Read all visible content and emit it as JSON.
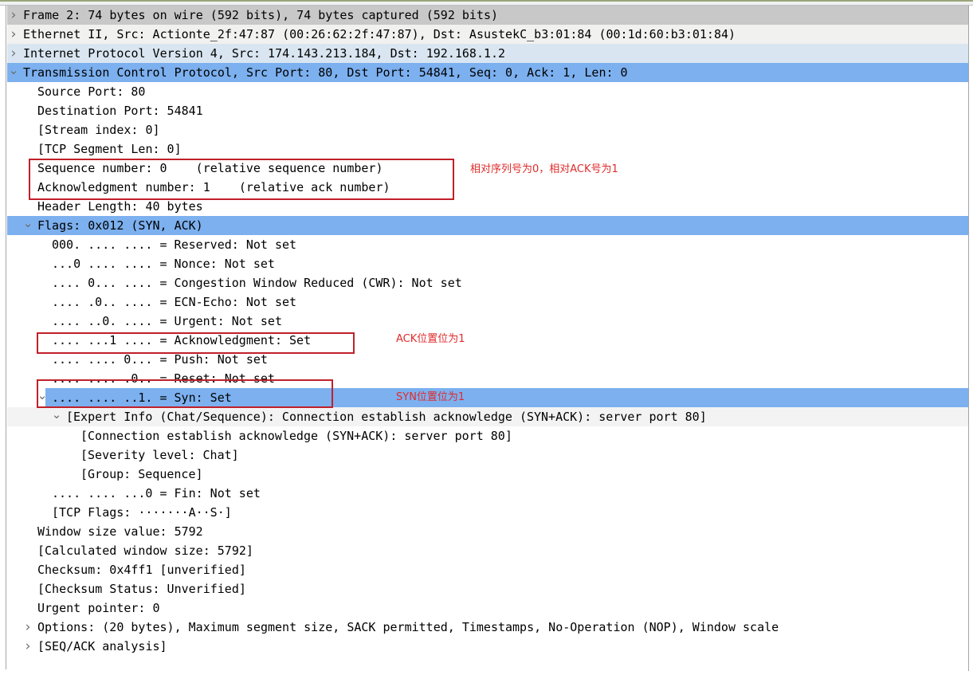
{
  "window": {
    "title": "Wireshark Packet Details",
    "background_color": "#ffffff"
  },
  "colors": {
    "row_frame_bg": "#c8c8c8",
    "row_ethernet_bg": "#f1f1f0",
    "row_ip_bg": "#d9e6f1",
    "row_selected_bg": "#7cb0ef",
    "annotation_red": "#e02b2b",
    "redbox_border": "#c0202a",
    "text": "#000000"
  },
  "tree": {
    "rows": [
      {
        "id": "frame",
        "indent": 0,
        "arrow": "closed",
        "bg": "gray",
        "text": "Frame 2: 74 bytes on wire (592 bits), 74 bytes captured (592 bits)"
      },
      {
        "id": "ethernet",
        "indent": 0,
        "arrow": "closed",
        "bg": "white",
        "text": "Ethernet II, Src: Actionte_2f:47:87 (00:26:62:2f:47:87), Dst: AsustekC_b3:01:84 (00:1d:60:b3:01:84)"
      },
      {
        "id": "ipv4",
        "indent": 0,
        "arrow": "closed",
        "bg": "lblue",
        "text": "Internet Protocol Version 4, Src: 174.143.213.184, Dst: 192.168.1.2"
      },
      {
        "id": "tcp",
        "indent": 0,
        "arrow": "open",
        "bg": "sel",
        "text": "Transmission Control Protocol, Src Port: 80, Dst Port: 54841, Seq: 0, Ack: 1, Len: 0"
      },
      {
        "id": "src-port",
        "indent": 1,
        "arrow": "none",
        "bg": "plain",
        "text": "Source Port: 80"
      },
      {
        "id": "dst-port",
        "indent": 1,
        "arrow": "none",
        "bg": "plain",
        "text": "Destination Port: 54841"
      },
      {
        "id": "stream-index",
        "indent": 1,
        "arrow": "none",
        "bg": "plain",
        "text": "[Stream index: 0]"
      },
      {
        "id": "segment-len",
        "indent": 1,
        "arrow": "none",
        "bg": "plain",
        "text": "[TCP Segment Len: 0]"
      },
      {
        "id": "seq-number",
        "indent": 1,
        "arrow": "none",
        "bg": "plain",
        "text": "Sequence number: 0    (relative sequence number)"
      },
      {
        "id": "ack-number",
        "indent": 1,
        "arrow": "none",
        "bg": "plain",
        "text": "Acknowledgment number: 1    (relative ack number)"
      },
      {
        "id": "header-len",
        "indent": 1,
        "arrow": "none",
        "bg": "plain",
        "text": "Header Length: 40 bytes"
      },
      {
        "id": "flags",
        "indent": 1,
        "arrow": "open",
        "bg": "sel",
        "text": "Flags: 0x012 (SYN, ACK)"
      },
      {
        "id": "flag-reserved",
        "indent": 2,
        "arrow": "none",
        "bg": "plain",
        "text": "000. .... .... = Reserved: Not set"
      },
      {
        "id": "flag-nonce",
        "indent": 2,
        "arrow": "none",
        "bg": "plain",
        "text": "...0 .... .... = Nonce: Not set"
      },
      {
        "id": "flag-cwr",
        "indent": 2,
        "arrow": "none",
        "bg": "plain",
        "text": ".... 0... .... = Congestion Window Reduced (CWR): Not set"
      },
      {
        "id": "flag-ecn",
        "indent": 2,
        "arrow": "none",
        "bg": "plain",
        "text": ".... .0.. .... = ECN-Echo: Not set"
      },
      {
        "id": "flag-urgent",
        "indent": 2,
        "arrow": "none",
        "bg": "plain",
        "text": ".... ..0. .... = Urgent: Not set"
      },
      {
        "id": "flag-ack",
        "indent": 2,
        "arrow": "none",
        "bg": "plain",
        "text": ".... ...1 .... = Acknowledgment: Set"
      },
      {
        "id": "flag-push",
        "indent": 2,
        "arrow": "none",
        "bg": "plain",
        "text": ".... .... 0... = Push: Not set"
      },
      {
        "id": "flag-reset",
        "indent": 2,
        "arrow": "none",
        "bg": "plain",
        "text": ".... .... .0.. = Reset: Not set"
      },
      {
        "id": "flag-syn",
        "indent": 2,
        "arrow": "open",
        "bg": "sel-inline",
        "text": ".... .... ..1. = Syn: Set"
      },
      {
        "id": "expert-info",
        "indent": 3,
        "arrow": "open",
        "bg": "faint",
        "text": "[Expert Info (Chat/Sequence): Connection establish acknowledge (SYN+ACK): server port 80]"
      },
      {
        "id": "expert-msg",
        "indent": 4,
        "arrow": "none",
        "bg": "plain",
        "text": "[Connection establish acknowledge (SYN+ACK): server port 80]"
      },
      {
        "id": "severity",
        "indent": 4,
        "arrow": "none",
        "bg": "plain",
        "text": "[Severity level: Chat]"
      },
      {
        "id": "group",
        "indent": 4,
        "arrow": "none",
        "bg": "plain",
        "text": "[Group: Sequence]"
      },
      {
        "id": "flag-fin",
        "indent": 2,
        "arrow": "none",
        "bg": "plain",
        "text": ".... .... ...0 = Fin: Not set"
      },
      {
        "id": "tcp-flags",
        "indent": 2,
        "arrow": "none",
        "bg": "plain",
        "text": "[TCP Flags: ·······A··S·]"
      },
      {
        "id": "window-size",
        "indent": 1,
        "arrow": "none",
        "bg": "plain",
        "text": "Window size value: 5792"
      },
      {
        "id": "calc-window",
        "indent": 1,
        "arrow": "none",
        "bg": "plain",
        "text": "[Calculated window size: 5792]"
      },
      {
        "id": "checksum",
        "indent": 1,
        "arrow": "none",
        "bg": "plain",
        "text": "Checksum: 0x4ff1 [unverified]"
      },
      {
        "id": "checksum-status",
        "indent": 1,
        "arrow": "none",
        "bg": "plain",
        "text": "[Checksum Status: Unverified]"
      },
      {
        "id": "urgent-ptr",
        "indent": 1,
        "arrow": "none",
        "bg": "plain",
        "text": "Urgent pointer: 0"
      },
      {
        "id": "options",
        "indent": 1,
        "arrow": "closed",
        "bg": "plain",
        "text": "Options: (20 bytes), Maximum segment size, SACK permitted, Timestamps, No-Operation (NOP), Window scale"
      },
      {
        "id": "seq-ack-analysis",
        "indent": 1,
        "arrow": "closed",
        "bg": "plain",
        "text": "[SEQ/ACK analysis]"
      }
    ]
  },
  "annotations": {
    "notes": [
      {
        "id": "note-seq-ack",
        "text": "相对序列号为0，相对ACK号为1"
      },
      {
        "id": "note-ack-bit",
        "text": "ACK位置位为1"
      },
      {
        "id": "note-syn-bit",
        "text": "SYN位置位为1"
      }
    ]
  }
}
